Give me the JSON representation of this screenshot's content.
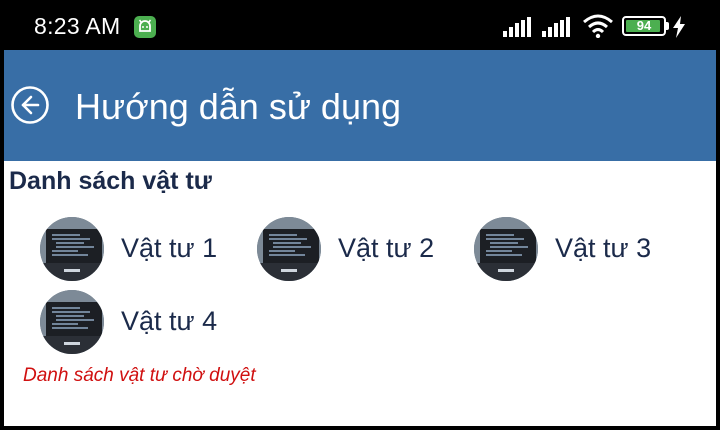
{
  "status_bar": {
    "time": "8:23 AM",
    "battery_level": 94,
    "battery_text": "94",
    "battery_color": "#4caf50",
    "notification_icon": "android-robot-icon"
  },
  "app_bar": {
    "title": "Hướng dẫn sử dụng",
    "background_color": "#386ea6",
    "back_icon": "back-arrow-circle-icon"
  },
  "main": {
    "section_title": "Danh sách vật tư",
    "items": [
      {
        "label": "Vật tư 1"
      },
      {
        "label": "Vật tư 2"
      },
      {
        "label": "Vật tư 3"
      },
      {
        "label": "Vật tư 4"
      }
    ],
    "pending_note": "Danh sách vật tư chờ duyệt",
    "pending_note_color": "#d01010"
  }
}
